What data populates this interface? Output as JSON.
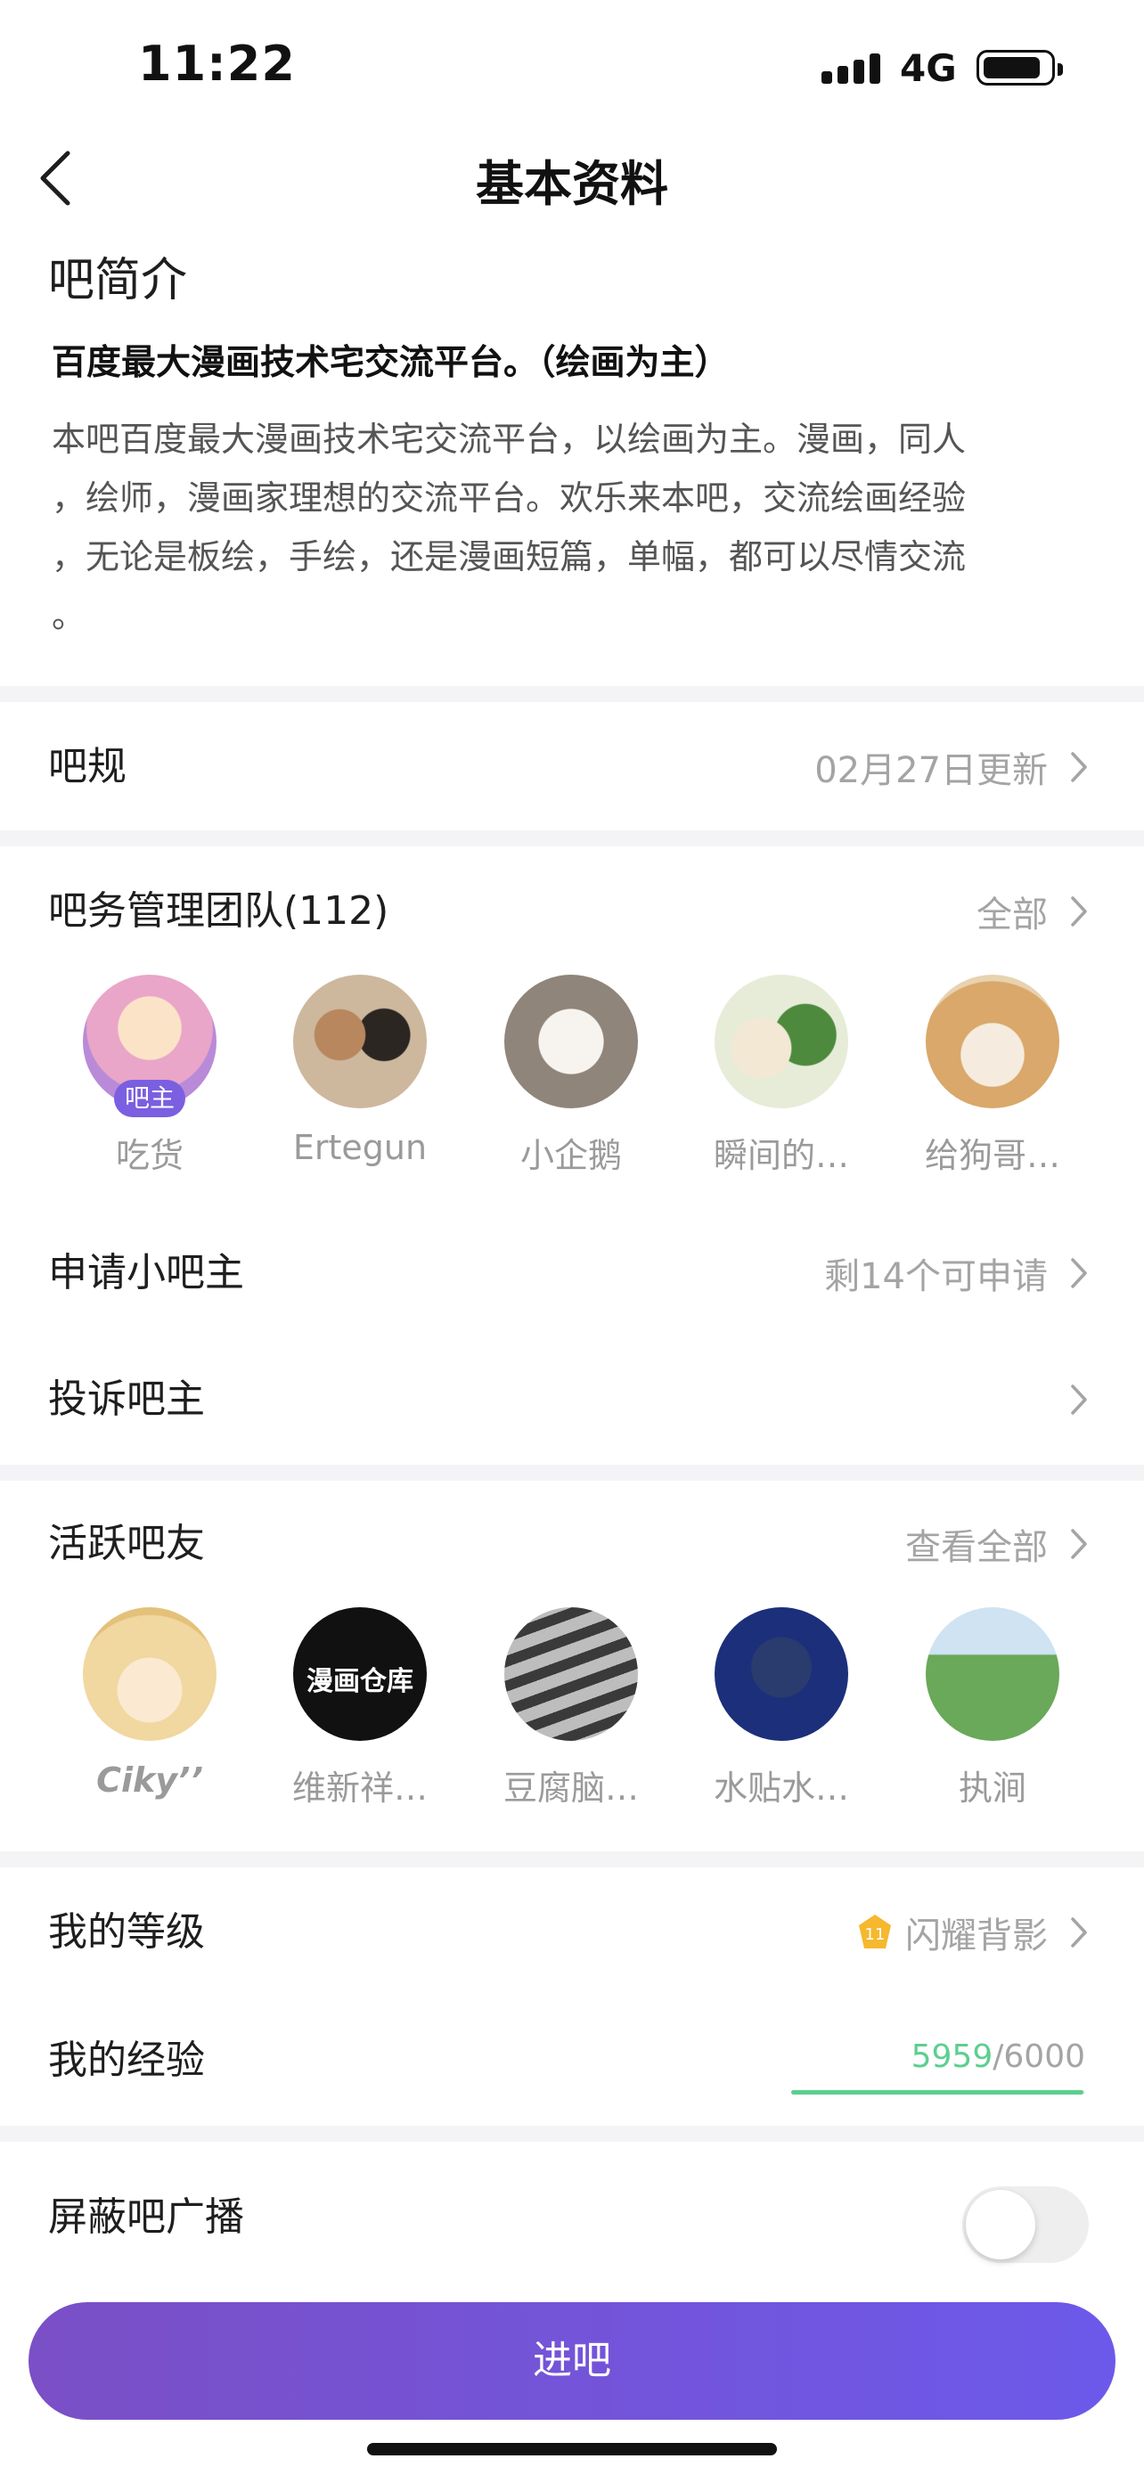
{
  "status_bar": {
    "time": "11:22",
    "network": "4G"
  },
  "nav": {
    "title": "基本资料"
  },
  "intro": {
    "heading": "吧简介",
    "subtitle": "百度最大漫画技术宅交流平台。（绘画为主）",
    "body_lines": [
      "本吧百度最大漫画技术宅交流平台，以绘画为主。漫画，同人",
      "，绘师，漫画家理想的交流平台。欢乐来本吧，交流绘画经验",
      "，无论是板绘，手绘，还是漫画短篇，单幅，都可以尽情交流",
      "。"
    ]
  },
  "rules": {
    "label": "吧规",
    "value": "02月27日更新"
  },
  "team": {
    "label": "吧务管理团队(112)",
    "value": "全部",
    "owner_badge": "吧主",
    "members": [
      {
        "name": "吃货",
        "color": "#e9a6c8"
      },
      {
        "name": "Ertegun",
        "color": "#8a6b52"
      },
      {
        "name": "小企鹅",
        "color": "#c9c2b8"
      },
      {
        "name": "瞬间的…",
        "color": "#bfcf9a"
      },
      {
        "name": "给狗哥…",
        "color": "#d9a86a"
      }
    ]
  },
  "apply": {
    "label": "申请小吧主",
    "value": "剩14个可申请"
  },
  "report": {
    "label": "投诉吧主"
  },
  "active": {
    "label": "活跃吧友",
    "value": "查看全部",
    "members": [
      {
        "name": "Ciky’’",
        "color": "#f1d7a0"
      },
      {
        "name": "维新祥…",
        "color": "#111111",
        "logo_text": "漫画仓库"
      },
      {
        "name": "豆腐脑…",
        "color": "#9a9a9a"
      },
      {
        "name": "水贴水…",
        "color": "#1c2f7a"
      },
      {
        "name": "执涧",
        "color": "#6aa85a"
      }
    ]
  },
  "level": {
    "label": "我的等级",
    "badge_number": "11",
    "value": "闪耀背影"
  },
  "experience": {
    "label": "我的经验",
    "current": "5959",
    "total": "/6000",
    "progress": 0.993
  },
  "block_broadcast": {
    "label": "屏蔽吧广播",
    "enabled": false
  },
  "enter_button": {
    "label": "进吧"
  },
  "colors": {
    "accent_purple": "#7a5fe0",
    "exp_green": "#5ccf8f",
    "gold": "#f5b82e"
  }
}
